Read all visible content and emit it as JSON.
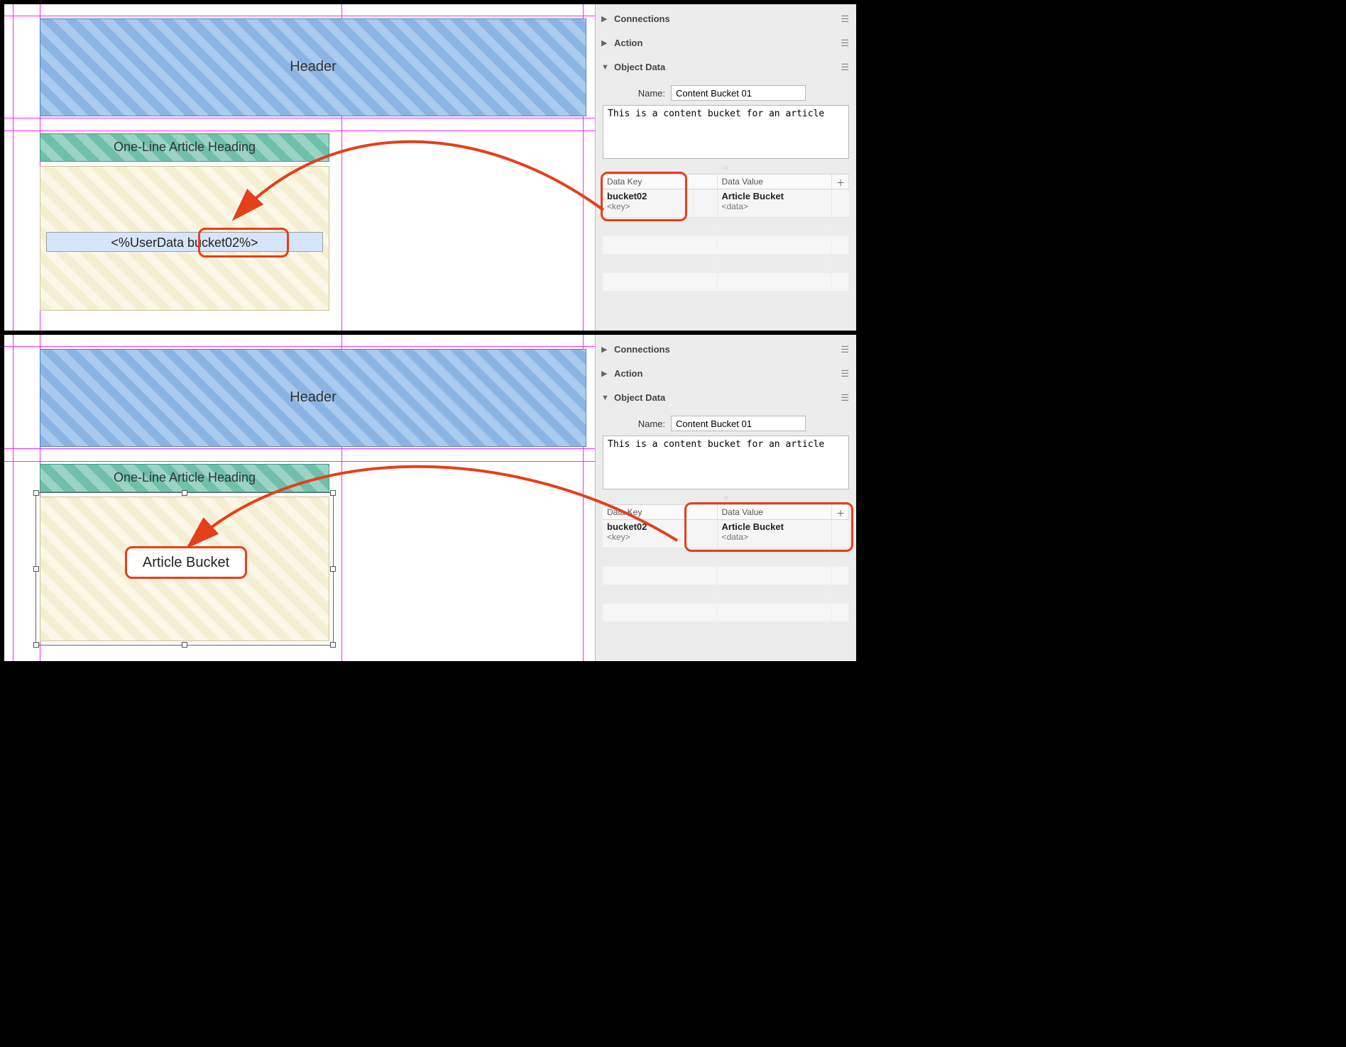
{
  "panels": [
    {
      "canvas": {
        "header_label": "Header",
        "heading_label": "One-Line Article Heading",
        "slot_text_parts": {
          "prefix": "<%UserData ",
          "key": "bucket02",
          "suffix": "%>"
        },
        "slot_text_full": "<%UserData bucket02%>"
      },
      "inspector": {
        "sections": {
          "connections": "Connections",
          "action": "Action",
          "object_data": "Object Data"
        },
        "name_label": "Name:",
        "name_value": "Content Bucket 01",
        "notes_value": "This is a content bucket for an article",
        "kv": {
          "head_key": "Data Key",
          "head_value": "Data Value",
          "row": {
            "key": "bucket02",
            "key_type": "<key>",
            "value": "Article Bucket",
            "value_type": "<data>"
          }
        }
      },
      "highlight": "key"
    },
    {
      "canvas": {
        "header_label": "Header",
        "heading_label": "One-Line Article Heading",
        "result_text": "Article Bucket"
      },
      "inspector": {
        "sections": {
          "connections": "Connections",
          "action": "Action",
          "object_data": "Object Data"
        },
        "name_label": "Name:",
        "name_value": "Content Bucket 01",
        "notes_value": "This is a content bucket for an article",
        "kv": {
          "head_key": "Data Key",
          "head_value": "Data Value",
          "row": {
            "key": "bucket02",
            "key_type": "<key>",
            "value": "Article Bucket",
            "value_type": "<data>"
          }
        }
      },
      "highlight": "value"
    }
  ]
}
